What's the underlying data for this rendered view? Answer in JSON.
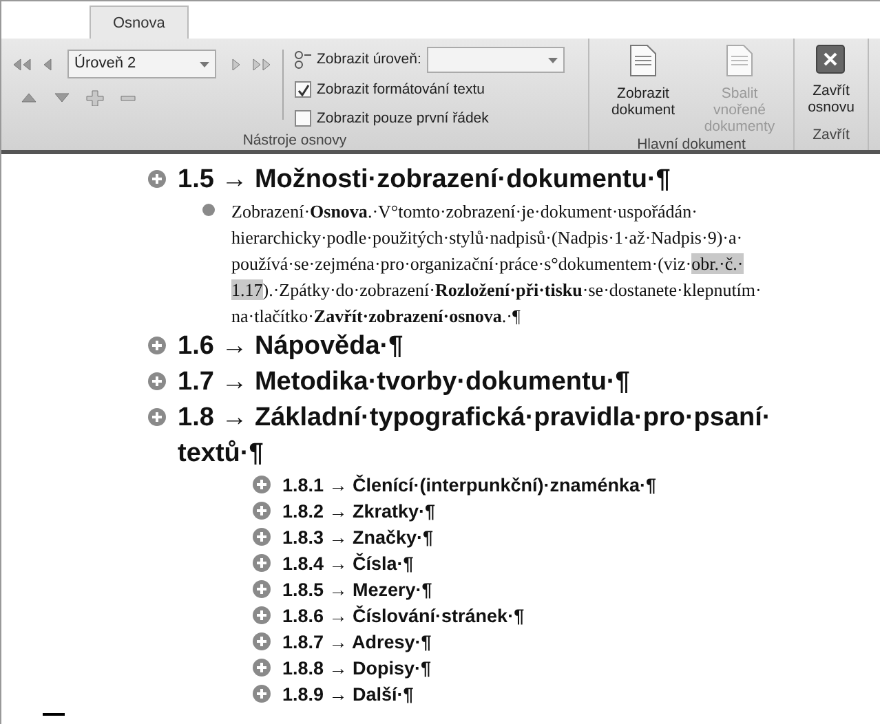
{
  "tabs": [
    {
      "label": "Osnova",
      "selected": true
    }
  ],
  "outline_tools": {
    "level_dropdown": "Úroveň 2",
    "show_level_label": "Zobrazit úroveň:",
    "checkboxes": [
      {
        "label": "Zobrazit formátování textu",
        "checked": true
      },
      {
        "label": "Zobrazit pouze první řádek",
        "checked": false
      }
    ],
    "group_label": "Nástroje osnovy"
  },
  "master_document": {
    "buttons": [
      {
        "label": "Zobrazit dokument",
        "disabled": false
      },
      {
        "label": "Sbalit vnořené dokumenty",
        "disabled": true
      }
    ],
    "group_label": "Hlavní dokument"
  },
  "close": {
    "button": "Zavřít osnovu",
    "group_label": "Zavřít"
  },
  "outline": [
    {
      "kind": "heading",
      "number": "1.5",
      "tab": "→",
      "title": "Možnosti·zobrazení·dokumentu·¶",
      "children": [
        {
          "kind": "body",
          "runs": [
            {
              "kind": "plain",
              "text": "Zobrazení·"
            },
            {
              "kind": "bold",
              "text": "Osnova"
            },
            {
              "kind": "plain",
              "text": ".·V°tomto·zobrazení·je·dokument·uspořádán· hierarchicky·podle·použitých·stylů·nadpisů·(Nadpis·1·až·Nadpis·9)·a· používá·se·zejména·pro·organizační·práce·s°dokumentem·(viz·"
            },
            {
              "kind": "field",
              "text": "obr.·č.· 1.17"
            },
            {
              "kind": "plain",
              "text": ").·Zpátky·do·zobrazení·"
            },
            {
              "kind": "bold",
              "text": "Rozložení·při·tisku"
            },
            {
              "kind": "plain",
              "text": "·se·dostanete·klepnutím· na·tlačítko·"
            },
            {
              "kind": "bold",
              "text": "Zavřít·zobrazení·osnova"
            },
            {
              "kind": "plain",
              "text": ".·¶"
            }
          ]
        }
      ]
    },
    {
      "kind": "heading",
      "number": "1.6",
      "tab": "→",
      "title": "Nápověda·¶"
    },
    {
      "kind": "heading",
      "number": "1.7",
      "tab": "→",
      "title": "Metodika·tvorby·dokumentu·¶"
    },
    {
      "kind": "heading",
      "number": "1.8",
      "tab": "→",
      "title": "Základní·typografická·pravidla·pro·psaní· textů·¶",
      "children": [
        {
          "kind": "heading",
          "number": "1.8.1",
          "tab": "→",
          "title": "Členící·(interpunkční)·znaménka·¶"
        },
        {
          "kind": "heading",
          "number": "1.8.2",
          "tab": "→",
          "title": "Zkratky·¶"
        },
        {
          "kind": "heading",
          "number": "1.8.3",
          "tab": "→",
          "title": "Značky·¶"
        },
        {
          "kind": "heading",
          "number": "1.8.4",
          "tab": "→",
          "title": "Čísla·¶"
        },
        {
          "kind": "heading",
          "number": "1.8.5",
          "tab": "→",
          "title": "Mezery·¶"
        },
        {
          "kind": "heading",
          "number": "1.8.6",
          "tab": "→",
          "title": "Číslování·stránek·¶"
        },
        {
          "kind": "heading",
          "number": "1.8.7",
          "tab": "→",
          "title": "Adresy·¶"
        },
        {
          "kind": "heading",
          "number": "1.8.8",
          "tab": "→",
          "title": "Dopisy·¶"
        },
        {
          "kind": "heading",
          "number": "1.8.9",
          "tab": "→",
          "title": "Další·¶"
        }
      ]
    }
  ]
}
